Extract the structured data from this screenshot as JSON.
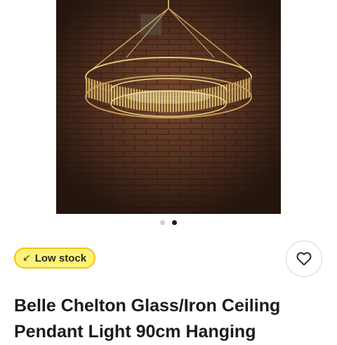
{
  "product": {
    "image_alt": "Belle Chelton glass and iron ring chandelier hanging in front of a brick wall",
    "carousel": {
      "total_slides": 2,
      "active_index": 1
    },
    "stock_badge": {
      "icon": "arrow-down-left-icon",
      "label": "Low stock"
    },
    "wishlist": {
      "icon": "heart-outline-icon"
    },
    "title": "Belle Chelton Glass/Iron Ceiling Pendant Light 90cm Hanging"
  },
  "colors": {
    "badge_background": "#fff27a",
    "badge_border": "#f1c40f",
    "text": "#1b1b1b",
    "dot_active": "#1a1a1a",
    "dot_inactive": "#cfcfcf"
  }
}
